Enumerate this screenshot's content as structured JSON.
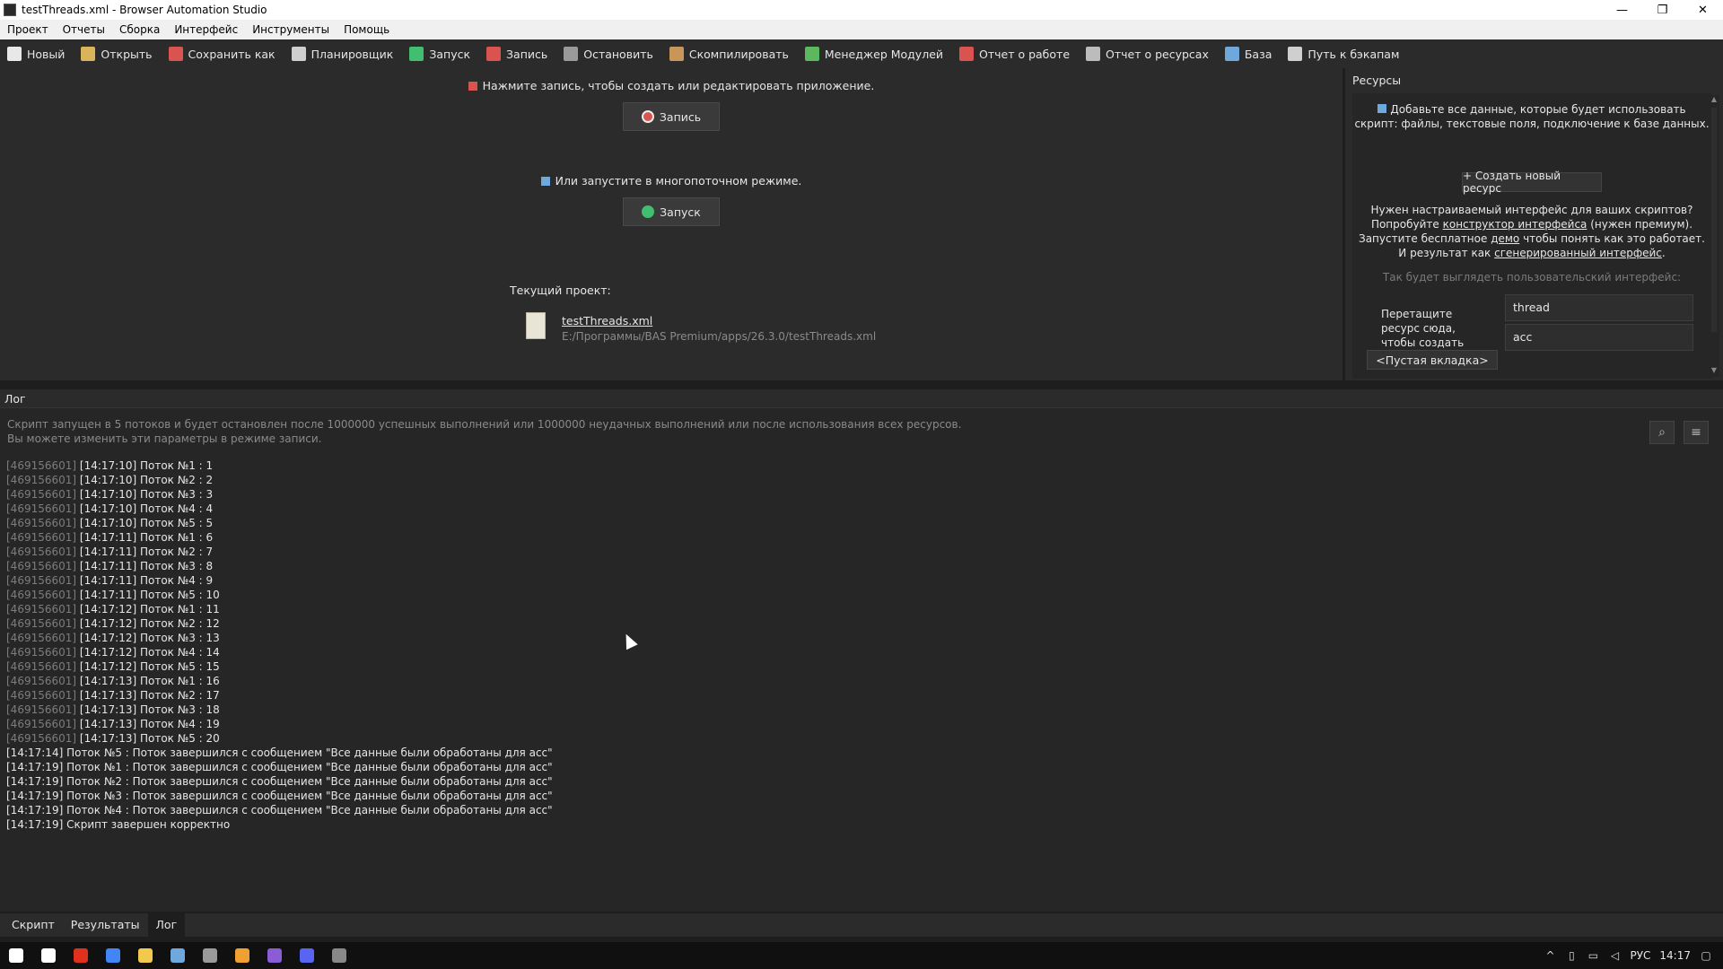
{
  "window": {
    "title": "testThreads.xml - Browser Automation Studio",
    "controls": [
      "—",
      "❐",
      "✕"
    ]
  },
  "menu": [
    "Проект",
    "Отчеты",
    "Сборка",
    "Интерфейс",
    "Инструменты",
    "Помощь"
  ],
  "toolbar": [
    {
      "label": "Новый",
      "icon": "new-file-icon",
      "color": "#e8e8e8"
    },
    {
      "label": "Открыть",
      "icon": "folder-icon",
      "color": "#d9b45a"
    },
    {
      "label": "Сохранить как",
      "icon": "save-icon",
      "color": "#d9534f"
    },
    {
      "label": "Планировщик",
      "icon": "calendar-icon",
      "color": "#cfcfcf"
    },
    {
      "label": "Запуск",
      "icon": "play-icon",
      "color": "#3fbf6f"
    },
    {
      "label": "Запись",
      "icon": "record-icon",
      "color": "#d9534f"
    },
    {
      "label": "Остановить",
      "icon": "stop-icon",
      "color": "#9a9a9a"
    },
    {
      "label": "Скомпилировать",
      "icon": "box-icon",
      "color": "#c8955a"
    },
    {
      "label": "Менеджер Модулей",
      "icon": "puzzle-icon",
      "color": "#5cb85c"
    },
    {
      "label": "Отчет о работе",
      "icon": "pie-chart-icon",
      "color": "#d9534f"
    },
    {
      "label": "Отчет о ресурсах",
      "icon": "list-icon",
      "color": "#bcbcbc"
    },
    {
      "label": "База",
      "icon": "database-icon",
      "color": "#6fa8dc"
    },
    {
      "label": "Путь к бэкапам",
      "icon": "backup-icon",
      "color": "#cfcfcf"
    }
  ],
  "main": {
    "record_hint": "Нажмите запись, чтобы создать или редактировать приложение.",
    "record_button": "Запись",
    "run_hint": "Или запустите в многопоточном режиме.",
    "run_button": "Запуск",
    "current_project_label": "Текущий проект:",
    "project_name": "testThreads.xml",
    "project_path": "E:/Программы/BAS Premium/apps/26.3.0/testThreads.xml"
  },
  "resources": {
    "title": "Ресурсы",
    "intro_line1": "Добавьте все данные, которые будет использовать",
    "intro_line2": "скрипт: файлы, текстовые поля, подключение к базе данных.",
    "create_button": "+ Создать новый ресурс",
    "ui_line1": "Нужен настраиваемый интерфейс для ваших скриптов?",
    "ui_line2a": "Попробуйте ",
    "ui_line2_link": "конструктор интерфейса",
    "ui_line2b": " (нужен премиум).",
    "ui_line3a": "Запустите бесплатное ",
    "ui_line3_link": "демо",
    "ui_line3b": " чтобы понять как это работает.",
    "ui_line4a": "И результат как ",
    "ui_line4_link": "сгенерированный интерфейс",
    "ui_line4b": ".",
    "preview_label": "Так будет выглядеть пользовательский интерфейс:",
    "drop_zone": "Перетащите ресурс сюда, чтобы создать новую вкладку",
    "fields": [
      "thread",
      "acc"
    ],
    "empty_tab": "<Пустая вкладка>"
  },
  "log": {
    "title": "Лог",
    "intro1": "Скрипт запущен в 5 потоков и будет остановлен после 1000000 успешных выполнений или 1000000 неудачных выполнений или после использования всех ресурсов.",
    "intro2": "Вы можете изменить эти параметры в режиме записи.",
    "lines": [
      {
        "id": "[469156601]",
        "text": " [14:17:10] Поток №1 : 1"
      },
      {
        "id": "[469156601]",
        "text": " [14:17:10] Поток №2 : 2"
      },
      {
        "id": "[469156601]",
        "text": " [14:17:10] Поток №3 : 3"
      },
      {
        "id": "[469156601]",
        "text": " [14:17:10] Поток №4 : 4"
      },
      {
        "id": "[469156601]",
        "text": " [14:17:10] Поток №5 : 5"
      },
      {
        "id": "[469156601]",
        "text": " [14:17:11] Поток №1 : 6"
      },
      {
        "id": "[469156601]",
        "text": " [14:17:11] Поток №2 : 7"
      },
      {
        "id": "[469156601]",
        "text": " [14:17:11] Поток №3 : 8"
      },
      {
        "id": "[469156601]",
        "text": " [14:17:11] Поток №4 : 9"
      },
      {
        "id": "[469156601]",
        "text": " [14:17:11] Поток №5 : 10"
      },
      {
        "id": "[469156601]",
        "text": " [14:17:12] Поток №1 : 11"
      },
      {
        "id": "[469156601]",
        "text": " [14:17:12] Поток №2 : 12"
      },
      {
        "id": "[469156601]",
        "text": " [14:17:12] Поток №3 : 13"
      },
      {
        "id": "[469156601]",
        "text": " [14:17:12] Поток №4 : 14"
      },
      {
        "id": "[469156601]",
        "text": " [14:17:12] Поток №5 : 15"
      },
      {
        "id": "[469156601]",
        "text": " [14:17:13] Поток №1 : 16"
      },
      {
        "id": "[469156601]",
        "text": " [14:17:13] Поток №2 : 17"
      },
      {
        "id": "[469156601]",
        "text": " [14:17:13] Поток №3 : 18"
      },
      {
        "id": "[469156601]",
        "text": " [14:17:13] Поток №4 : 19"
      },
      {
        "id": "[469156601]",
        "text": " [14:17:13] Поток №5 : 20"
      },
      {
        "id": "",
        "text": "[14:17:14] Поток №5 : Поток завершился с сообщением \"Все данные были обработаны для acc\""
      },
      {
        "id": "",
        "text": "[14:17:19] Поток №1 : Поток завершился с сообщением \"Все данные были обработаны для acc\""
      },
      {
        "id": "",
        "text": "[14:17:19] Поток №2 : Поток завершился с сообщением \"Все данные были обработаны для acc\""
      },
      {
        "id": "",
        "text": "[14:17:19] Поток №3 : Поток завершился с сообщением \"Все данные были обработаны для acc\""
      },
      {
        "id": "",
        "text": "[14:17:19] Поток №4 : Поток завершился с сообщением \"Все данные были обработаны для acc\""
      },
      {
        "id": "",
        "text": "[14:17:19] Скрипт завершен корректно"
      }
    ]
  },
  "bottom_tabs": [
    "Скрипт",
    "Результаты",
    "Лог"
  ],
  "taskbar": {
    "apps": [
      {
        "icon": "windows-start-icon",
        "color": "#ffffff"
      },
      {
        "icon": "search-icon",
        "color": "#ffffff"
      },
      {
        "icon": "yandex-browser-icon",
        "color": "#e0301e"
      },
      {
        "icon": "chrome-icon",
        "color": "#4285f4"
      },
      {
        "icon": "file-explorer-icon",
        "color": "#f2c94c"
      },
      {
        "icon": "notepad-icon",
        "color": "#6fa8dc"
      },
      {
        "icon": "terminal-icon",
        "color": "#9a9a9a"
      },
      {
        "icon": "app-icon",
        "color": "#f0a030"
      },
      {
        "icon": "visual-studio-icon",
        "color": "#8a5cd6"
      },
      {
        "icon": "discord-icon",
        "color": "#5865f2"
      },
      {
        "icon": "bas-icon",
        "color": "#888888"
      }
    ],
    "lang": "РУС",
    "time": "14:17"
  }
}
